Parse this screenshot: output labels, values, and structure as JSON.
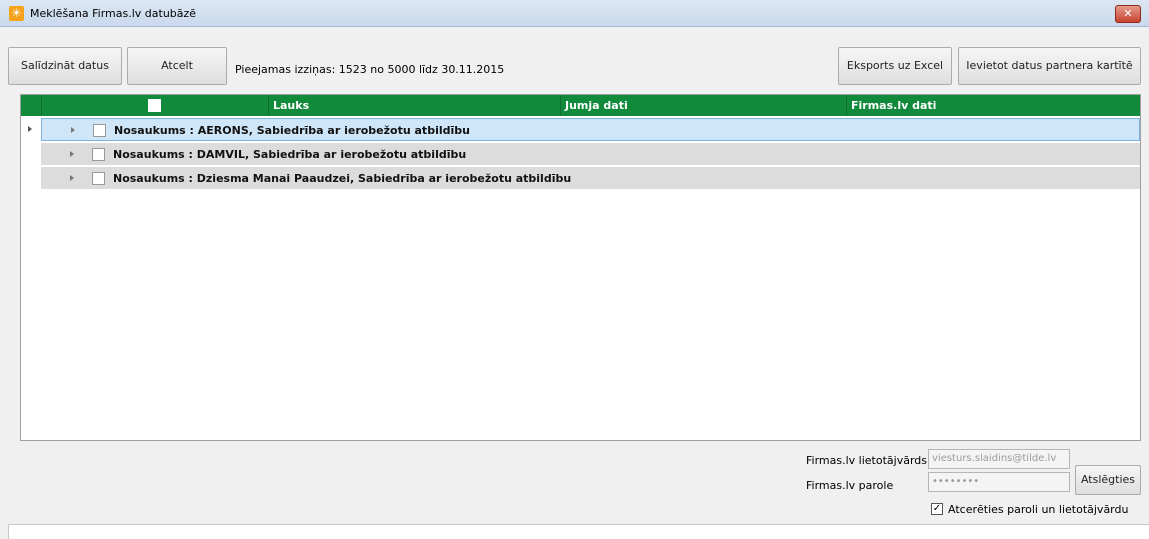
{
  "window": {
    "title": "Meklēšana Firmas.lv datubāzē",
    "close_glyph": "✕",
    "app_icon": "☀"
  },
  "toolbar": {
    "compare_label": "Salīdzināt datus",
    "cancel_label": "Atcelt",
    "info_text": "Pieejamas izziņas: 1523 no 5000 līdz 30.11.2015",
    "export_label": "Eksports uz Excel",
    "import_label": "Ievietot datus partnera kartītē"
  },
  "grid": {
    "columns": [
      "Lauks",
      "Jumja dati",
      "Firmas.lv dati"
    ],
    "header_color": "#128a3c",
    "rows": [
      {
        "text": "Nosaukums : AERONS, Sabiedrība ar ierobežotu atbildību",
        "selected": true
      },
      {
        "text": "Nosaukums : DAMVIL, Sabiedrība ar ierobežotu atbildību",
        "selected": false
      },
      {
        "text": "Nosaukums : Dziesma Manai Paaudzei, Sabiedrība ar ierobežotu atbildību",
        "selected": false
      }
    ]
  },
  "login": {
    "username_label": "Firmas.lv lietotājvārds",
    "username_value": "viesturs.slaidins@tilde.lv",
    "password_label": "Firmas.lv parole",
    "password_value": "••••••••",
    "disconnect_label": "Atslēgties",
    "remember_label": "Atcerēties paroli un lietotājvārdu",
    "remember_checked": true
  }
}
